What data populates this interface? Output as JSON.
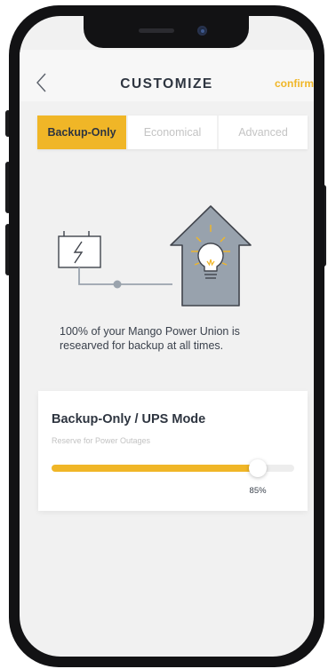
{
  "header": {
    "title": "CUSTOMIZE",
    "back_icon": "chevron-left-icon",
    "confirm_label": "confirm"
  },
  "tabs": [
    {
      "label": "Backup-Only",
      "active": true
    },
    {
      "label": "Economical",
      "active": false
    },
    {
      "label": "Advanced",
      "active": false
    }
  ],
  "illustration": {
    "battery_icon": "battery-lightning-icon",
    "house_icon": "house-lightbulb-icon"
  },
  "description": "100% of your Mango Power Union is researved for backup at all times.",
  "mode_card": {
    "title": "Backup-Only / UPS Mode",
    "subtitle": "Reserve for Power Outages",
    "slider_value_percent": 85,
    "slider_value_label": "85%"
  },
  "colors": {
    "accent": "#f0b627",
    "text_dark": "#2e3540",
    "background": "#f1f1f1",
    "house_fill": "#98a2ad",
    "inactive_tab_text": "#c4c4c4"
  }
}
